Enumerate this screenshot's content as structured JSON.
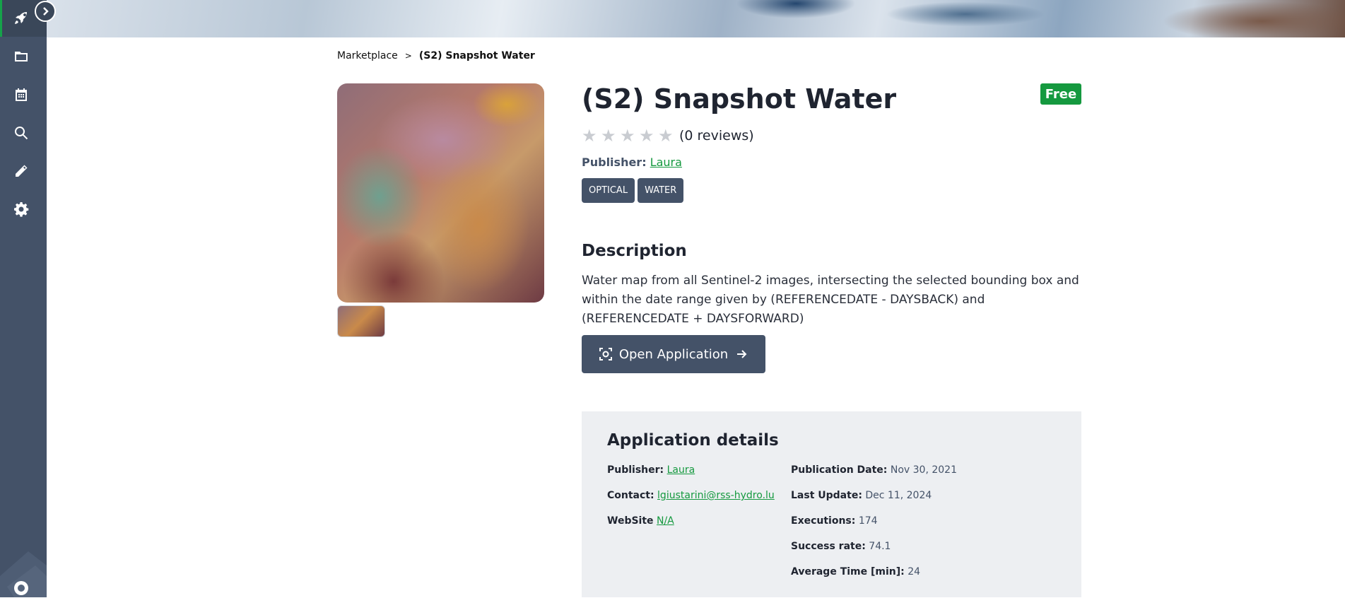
{
  "breadcrumb": {
    "marketplace": "Marketplace",
    "separator": ">",
    "current": "(S2) Snapshot Water"
  },
  "app": {
    "title": "(S2) Snapshot Water",
    "price_badge": "Free",
    "rating": 0,
    "rating_max": 5,
    "reviews_text": "(0 reviews)",
    "publisher_label": "Publisher:",
    "publisher_name": "Laura",
    "tags": [
      "OPTICAL",
      "WATER"
    ]
  },
  "description": {
    "heading": "Description",
    "text": "Water map from all Sentinel-2 images, intersecting the selected bounding box and within the date range given by (REFERENCEDATE - DAYSBACK) and (REFERENCEDATE + DAYSFORWARD)"
  },
  "open_button": {
    "label": "Open Application"
  },
  "details": {
    "heading": "Application details",
    "publisher_label": "Publisher:",
    "publisher_value": "Laura",
    "contact_label": "Contact:",
    "contact_value": "lgiustarini@rss-hydro.lu",
    "website_label": "WebSite",
    "website_value": "N/A",
    "publication_date_label": "Publication Date:",
    "publication_date_value": "Nov 30, 2021",
    "last_update_label": "Last Update:",
    "last_update_value": "Dec 11, 2024",
    "executions_label": "Executions:",
    "executions_value": "174",
    "success_rate_label": "Success rate:",
    "success_rate_value": "74.1",
    "average_time_label": "Average Time [min]:",
    "average_time_value": "24"
  },
  "sidebar": {
    "icons": [
      "rocket-icon",
      "folder-icon",
      "calendar-icon",
      "search-icon",
      "pencil-icon",
      "gear-icon",
      "lifebuoy-icon"
    ]
  },
  "colors": {
    "sidebar": "#445268",
    "accent_green": "#15993f",
    "tag_bg": "#445268",
    "details_bg": "#edeff2"
  }
}
